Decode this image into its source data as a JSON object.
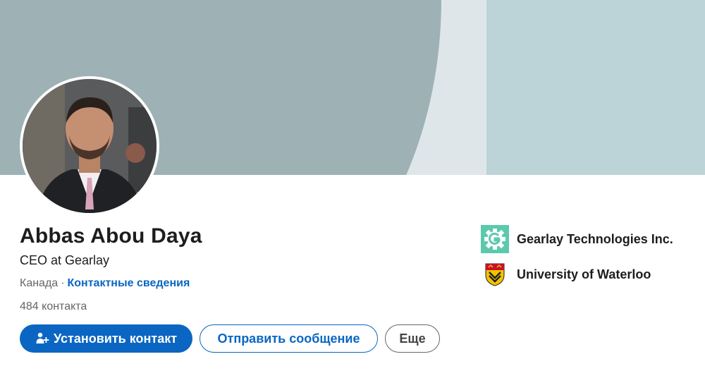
{
  "profile": {
    "name": "Abbas Abou Daya",
    "headline": "CEO at Gearlay",
    "location": "Канада",
    "separator": "·",
    "contact_info_link": "Контактные сведения",
    "connections": "484 контакта"
  },
  "actions": {
    "connect_label": "Установить контакт",
    "message_label": "Отправить сообщение",
    "more_label": "Еще"
  },
  "experience": {
    "company": "Gearlay Technologies Inc.",
    "school": "University of Waterloo"
  },
  "icons": {
    "connect": "add-person-icon",
    "company_logo": "gear-g-logo",
    "school_logo": "university-crest"
  },
  "colors": {
    "primary": "#0a66c2",
    "banner_left": "#9eb2b6",
    "banner_right": "#bcd3d7",
    "company_logo": "#5cc9ad"
  }
}
